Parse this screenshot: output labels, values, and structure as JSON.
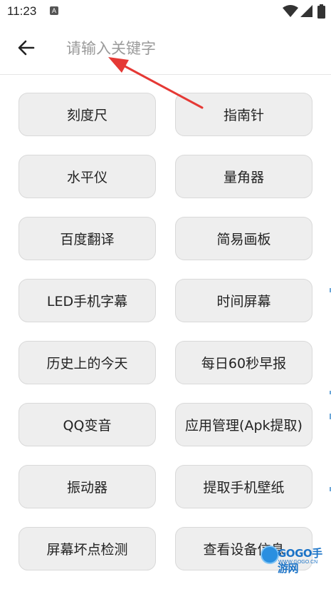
{
  "status_bar": {
    "time": "11:23",
    "app_icon_letter": "A"
  },
  "search": {
    "placeholder": "请输入关键字",
    "value": ""
  },
  "tools": [
    {
      "label": "刻度尺"
    },
    {
      "label": "指南针"
    },
    {
      "label": "水平仪"
    },
    {
      "label": "量角器"
    },
    {
      "label": "百度翻译"
    },
    {
      "label": "简易画板"
    },
    {
      "label": "LED手机字幕"
    },
    {
      "label": "时间屏幕"
    },
    {
      "label": "历史上的今天"
    },
    {
      "label": "每日60秒早报"
    },
    {
      "label": "QQ变音"
    },
    {
      "label": "应用管理(Apk提取)"
    },
    {
      "label": "振动器"
    },
    {
      "label": "提取手机壁纸"
    },
    {
      "label": "屏幕坏点检测"
    },
    {
      "label": "查看设备信息"
    }
  ],
  "annotation": {
    "arrow_color": "#e53935"
  },
  "watermark": {
    "brand": "GOGO手游网",
    "site": "WWW.GOGO.CN"
  },
  "colors": {
    "button_bg": "#eeeeee",
    "button_border": "#d9d9d9",
    "text": "#222222",
    "placeholder": "#9a9a9a",
    "watermark": "#1b73c7"
  }
}
